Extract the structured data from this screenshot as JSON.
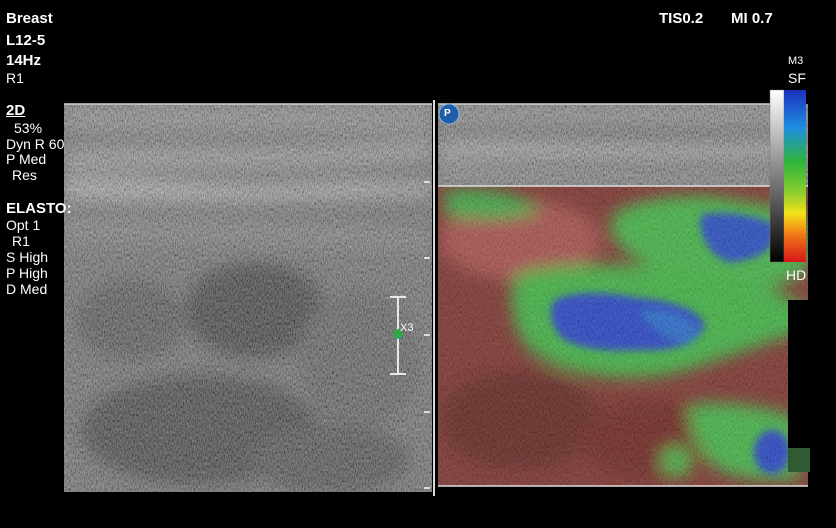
{
  "header": {
    "exam": "Breast",
    "probe": "L12-5",
    "frame_rate": "14Hz",
    "preset": "R1",
    "tis": "TIS0.2",
    "mi": "MI 0.7"
  },
  "params_2d": {
    "mode": "2D",
    "gain": "53%",
    "dynamic_range": "Dyn R 60",
    "persistence": "P Med",
    "resolution": "Res"
  },
  "params_elasto": {
    "mode": "ELASTO:",
    "opt": "Opt 1",
    "preset": "R1",
    "s": "S High",
    "p": "P High",
    "d": "D Med"
  },
  "color_bar": {
    "map": "M3",
    "scale": "SF",
    "quality": "HD"
  },
  "image_tags": {
    "probe_marker": "P",
    "zoom": "X3"
  },
  "colors": {
    "stiff_blue": "#1a3cc8",
    "mid_green": "#32b43c",
    "soft_red": "#b43228",
    "marker_green": "#2fa84c"
  }
}
